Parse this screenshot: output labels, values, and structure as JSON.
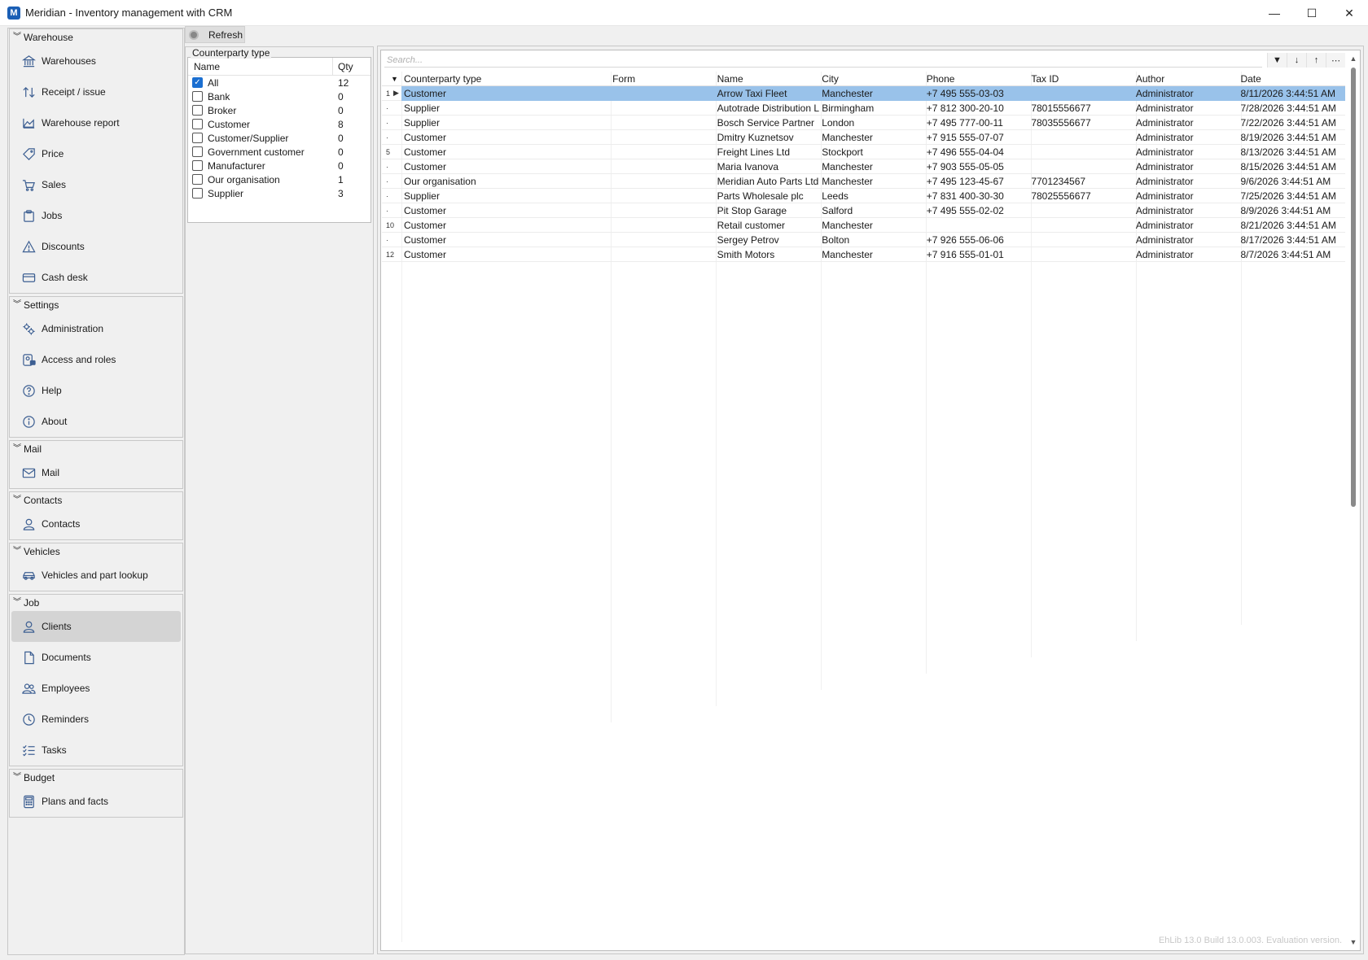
{
  "window": {
    "app_icon": "M",
    "title": "Meridian - Inventory management with CRM",
    "minimize": "—",
    "maximize": "☐",
    "close": "✕"
  },
  "sidebar": {
    "groups": [
      {
        "title": "Warehouse",
        "items": [
          {
            "label": "Warehouses",
            "icon": "bank-icon"
          },
          {
            "label": "Receipt / issue",
            "icon": "transfer-icon"
          },
          {
            "label": "Warehouse report",
            "icon": "chart-area-icon"
          },
          {
            "label": "Price",
            "icon": "tag-icon"
          },
          {
            "label": "Sales",
            "icon": "cart-icon"
          },
          {
            "label": "Jobs",
            "icon": "clipboard-icon"
          },
          {
            "label": "Discounts",
            "icon": "warning-icon"
          },
          {
            "label": "Cash desk",
            "icon": "card-icon"
          }
        ]
      },
      {
        "title": "Settings",
        "items": [
          {
            "label": "Administration",
            "icon": "gears-icon"
          },
          {
            "label": "Access and roles",
            "icon": "user-lock-icon"
          },
          {
            "label": "Help",
            "icon": "help-icon"
          },
          {
            "label": "About",
            "icon": "info-icon"
          }
        ]
      },
      {
        "title": "Mail",
        "items": [
          {
            "label": "Mail",
            "icon": "mail-icon"
          }
        ]
      },
      {
        "title": "Contacts",
        "items": [
          {
            "label": "Contacts",
            "icon": "person-icon"
          }
        ]
      },
      {
        "title": "Vehicles",
        "items": [
          {
            "label": "Vehicles and part lookup",
            "icon": "car-icon"
          }
        ]
      },
      {
        "title": "Job",
        "items": [
          {
            "label": "Clients",
            "icon": "person-icon",
            "active": true
          },
          {
            "label": "Documents",
            "icon": "document-icon"
          },
          {
            "label": "Employees",
            "icon": "people-icon"
          },
          {
            "label": "Reminders",
            "icon": "clock-icon"
          },
          {
            "label": "Tasks",
            "icon": "tasks-icon"
          }
        ]
      },
      {
        "title": "Budget",
        "items": [
          {
            "label": "Plans and facts",
            "icon": "calculator-icon"
          }
        ]
      }
    ]
  },
  "toolbar": {
    "refresh_label": "Refresh"
  },
  "filter": {
    "title": "Counterparty type",
    "columns": [
      "Name",
      "Qty"
    ],
    "rows": [
      {
        "name": "All",
        "qty": "12",
        "checked": true
      },
      {
        "name": "Bank",
        "qty": "0",
        "checked": false
      },
      {
        "name": "Broker",
        "qty": "0",
        "checked": false
      },
      {
        "name": "Customer",
        "qty": "8",
        "checked": false
      },
      {
        "name": "Customer/Supplier",
        "qty": "0",
        "checked": false
      },
      {
        "name": "Government customer",
        "qty": "0",
        "checked": false
      },
      {
        "name": "Manufacturer",
        "qty": "0",
        "checked": false
      },
      {
        "name": "Our organisation",
        "qty": "1",
        "checked": false
      },
      {
        "name": "Supplier",
        "qty": "3",
        "checked": false
      }
    ]
  },
  "grid": {
    "search_placeholder": "Search...",
    "columns": [
      "Counterparty type",
      "Form",
      "Name",
      "City",
      "Phone",
      "Tax ID",
      "Author",
      "Date"
    ],
    "rows": [
      {
        "num": "1",
        "type": "Customer",
        "form": "",
        "name": "Arrow Taxi Fleet",
        "city": "Manchester",
        "phone": "+7 495 555-03-03",
        "tax": "",
        "author": "Administrator",
        "date": "8/11/2026 3:44:51 AM",
        "selected": true
      },
      {
        "num": "·",
        "type": "Supplier",
        "form": "",
        "name": "Autotrade Distribution L",
        "city": "Birmingham",
        "phone": "+7 812 300-20-10",
        "tax": "78015556677",
        "author": "Administrator",
        "date": "7/28/2026 3:44:51 AM"
      },
      {
        "num": "·",
        "type": "Supplier",
        "form": "",
        "name": "Bosch Service Partner",
        "city": "London",
        "phone": "+7 495 777-00-11",
        "tax": "78035556677",
        "author": "Administrator",
        "date": "7/22/2026 3:44:51 AM"
      },
      {
        "num": "·",
        "type": "Customer",
        "form": "",
        "name": "Dmitry Kuznetsov",
        "city": "Manchester",
        "phone": "+7 915 555-07-07",
        "tax": "",
        "author": "Administrator",
        "date": "8/19/2026 3:44:51 AM"
      },
      {
        "num": "5",
        "type": "Customer",
        "form": "",
        "name": "Freight Lines Ltd",
        "city": "Stockport",
        "phone": "+7 496 555-04-04",
        "tax": "",
        "author": "Administrator",
        "date": "8/13/2026 3:44:51 AM"
      },
      {
        "num": "·",
        "type": "Customer",
        "form": "",
        "name": "Maria Ivanova",
        "city": "Manchester",
        "phone": "+7 903 555-05-05",
        "tax": "",
        "author": "Administrator",
        "date": "8/15/2026 3:44:51 AM"
      },
      {
        "num": "·",
        "type": "Our organisation",
        "form": "",
        "name": "Meridian Auto Parts Ltd",
        "city": "Manchester",
        "phone": "+7 495 123-45-67",
        "tax": "7701234567",
        "author": "Administrator",
        "date": "9/6/2026 3:44:51 AM"
      },
      {
        "num": "·",
        "type": "Supplier",
        "form": "",
        "name": "Parts Wholesale plc",
        "city": "Leeds",
        "phone": "+7 831 400-30-30",
        "tax": "78025556677",
        "author": "Administrator",
        "date": "7/25/2026 3:44:51 AM"
      },
      {
        "num": "·",
        "type": "Customer",
        "form": "",
        "name": "Pit Stop Garage",
        "city": "Salford",
        "phone": "+7 495 555-02-02",
        "tax": "",
        "author": "Administrator",
        "date": "8/9/2026 3:44:51 AM"
      },
      {
        "num": "10",
        "type": "Customer",
        "form": "",
        "name": "Retail customer",
        "city": "Manchester",
        "phone": "",
        "tax": "",
        "author": "Administrator",
        "date": "8/21/2026 3:44:51 AM"
      },
      {
        "num": "·",
        "type": "Customer",
        "form": "",
        "name": "Sergey Petrov",
        "city": "Bolton",
        "phone": "+7 926 555-06-06",
        "tax": "",
        "author": "Administrator",
        "date": "8/17/2026 3:44:51 AM"
      },
      {
        "num": "12",
        "type": "Customer",
        "form": "",
        "name": "Smith Motors",
        "city": "Manchester",
        "phone": "+7 916 555-01-01",
        "tax": "",
        "author": "Administrator",
        "date": "8/7/2026 3:44:51 AM"
      }
    ]
  },
  "watermark": "EhLib 13.0 Build 13.0.003. Evaluation version."
}
